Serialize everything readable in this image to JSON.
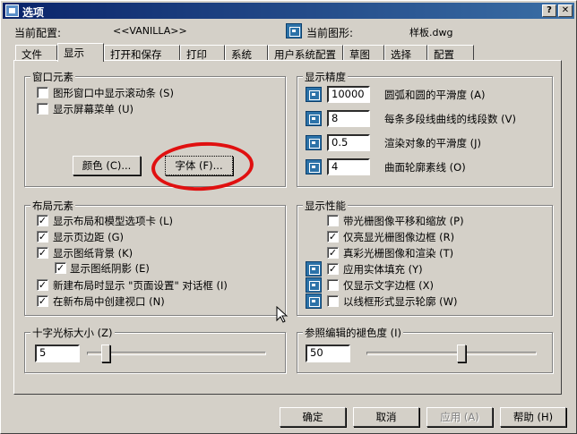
{
  "window": {
    "title": "选项"
  },
  "header": {
    "current_config_label": "当前配置:",
    "current_config_value": "<<VANILLA>>",
    "current_drawing_label": "当前图形:",
    "current_drawing_value": "样板.dwg"
  },
  "tabs": [
    {
      "label": "文件"
    },
    {
      "label": "显示"
    },
    {
      "label": "打开和保存"
    },
    {
      "label": "打印"
    },
    {
      "label": "系统"
    },
    {
      "label": "用户系统配置"
    },
    {
      "label": "草图"
    },
    {
      "label": "选择"
    },
    {
      "label": "配置"
    }
  ],
  "window_elements": {
    "title": "窗口元素",
    "items": [
      {
        "label": "图形窗口中显示滚动条 (S)",
        "checked": false
      },
      {
        "label": "显示屏幕菜单 (U)",
        "checked": false
      }
    ],
    "colors_button": "颜色 (C)...",
    "fonts_button": "字体 (F)..."
  },
  "display_resolution": {
    "title": "显示精度",
    "items": [
      {
        "value": "10000",
        "label": "圆弧和圆的平滑度 (A)"
      },
      {
        "value": "8",
        "label": "每条多段线曲线的线段数 (V)"
      },
      {
        "value": "0.5",
        "label": "渲染对象的平滑度 (J)"
      },
      {
        "value": "4",
        "label": "曲面轮廓素线 (O)"
      }
    ]
  },
  "layout_elements": {
    "title": "布局元素",
    "items": [
      {
        "label": "显示布局和模型选项卡 (L)",
        "checked": true
      },
      {
        "label": "显示页边距 (G)",
        "checked": true
      },
      {
        "label": "显示图纸背景 (K)",
        "checked": true
      },
      {
        "label": "显示图纸阴影 (E)",
        "checked": true
      },
      {
        "label": "新建布局时显示 \"页面设置\" 对话框 (I)",
        "checked": true
      },
      {
        "label": "在新布局中创建视口 (N)",
        "checked": true
      }
    ]
  },
  "display_performance": {
    "title": "显示性能",
    "items": [
      {
        "label": "带光栅图像平移和缩放 (P)",
        "checked": false,
        "icon": false
      },
      {
        "label": "仅亮显光栅图像边框 (R)",
        "checked": true,
        "icon": false
      },
      {
        "label": "真彩光栅图像和渲染 (T)",
        "checked": true,
        "icon": false
      },
      {
        "label": "应用实体填充 (Y)",
        "checked": true,
        "icon": true
      },
      {
        "label": "仅显示文字边框 (X)",
        "checked": false,
        "icon": true
      },
      {
        "label": "以线框形式显示轮廓 (W)",
        "checked": false,
        "icon": true
      }
    ]
  },
  "crosshair": {
    "title": "十字光标大小 (Z)",
    "value": "5",
    "level_percent": 5
  },
  "xref_fading": {
    "title": "参照编辑的褪色度 (I)",
    "value": "50",
    "level_percent": 50
  },
  "footer": {
    "ok": "确定",
    "cancel": "取消",
    "apply": "应用 (A)",
    "help": "帮助 (H)"
  }
}
